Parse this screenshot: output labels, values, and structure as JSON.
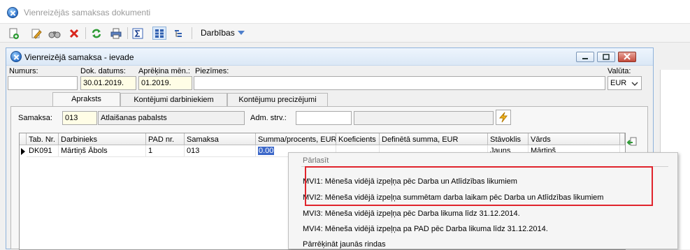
{
  "outer_window": {
    "title": "Vienreizējās samaksas dokumenti"
  },
  "toolbar": {
    "actions_label": "Darbības"
  },
  "inner_window": {
    "title": "Vienreizējā samaksa - ievade"
  },
  "form": {
    "numurs_label": "Numurs:",
    "numurs_value": "",
    "dok_datums_label": "Dok. datums:",
    "dok_datums_value": "30.01.2019.",
    "aprekina_label": "Aprēķina mēn.:",
    "aprekina_value": "01.2019.",
    "piezimes_label": "Piezīmes:",
    "piezimes_value": "",
    "valuta_label": "Valūta:",
    "valuta_value": "EUR"
  },
  "tabs": [
    {
      "label": "Apraksts",
      "active": true
    },
    {
      "label": "Kontējumi darbiniekiem",
      "active": false
    },
    {
      "label": "Kontējumu precizējumi",
      "active": false
    }
  ],
  "samaksa": {
    "label": "Samaksa:",
    "code": "013",
    "name": "Atlaišanas pabalsts",
    "adm_label": "Adm. strv.:",
    "adm_code": "",
    "adm_name": ""
  },
  "grid": {
    "columns": [
      "Tab. Nr.",
      "Darbinieks",
      "PAD nr.",
      "Samaksa",
      "Summa/procents, EUR",
      "Koeficients",
      "Definētā summa, EUR",
      "Stāvoklis",
      "Vārds"
    ],
    "rows": [
      [
        "DK091",
        "Mārtiņš Ābols",
        "1",
        "013",
        "0.00",
        "",
        "",
        "Jauns",
        "Mārtiņš"
      ]
    ]
  },
  "context_menu": {
    "header": "Pārlasīt",
    "items": [
      "MVI1: Mēneša vidējā izpeļņa pēc Darba un Atlīdzības likumiem",
      "MVI2: Mēneša vidējā izpeļņa summētam darba laikam pēc Darba un Atlīdzības likumiem",
      "MVI3: Mēneša vidējā izpeļņa pēc Darba likuma līdz 31.12.2014.",
      "MVI4: Mēneša vidējā izpeļņa pa PAD pēc Darba likuma līdz 31.12.2014.",
      "Pārrēķināt jaunās rindas"
    ]
  },
  "colors": {
    "highlight_box": "#e0242c",
    "selection": "#3b67c9",
    "required_field": "#fffde6"
  }
}
